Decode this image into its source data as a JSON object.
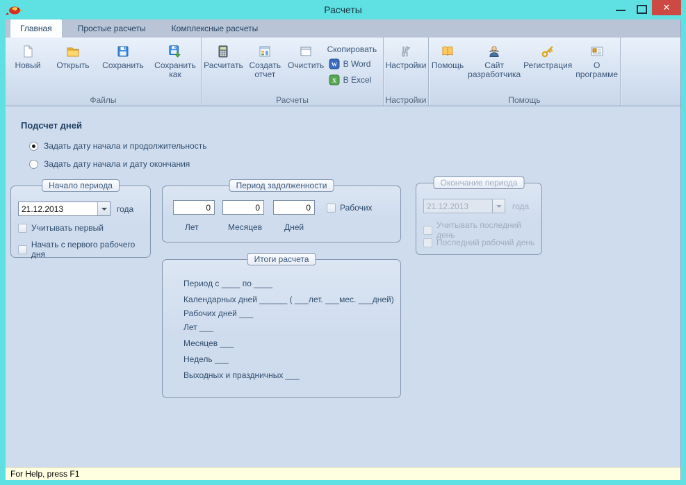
{
  "window": {
    "title": "Расчеты",
    "close_glyph": "✕",
    "status": "For Help, press F1"
  },
  "colors": {
    "frame": "#5fe0e2",
    "close_button": "#cd4a44",
    "content_bg": "#cfdcee",
    "status_bg": "#feffe1",
    "accent_text": "#3a567a"
  },
  "tabs": [
    {
      "label": "Главная",
      "active": true
    },
    {
      "label": "Простые расчеты",
      "active": false
    },
    {
      "label": "Комплексные расчеты",
      "active": false
    }
  ],
  "ribbon": {
    "groups": [
      {
        "label": "Файлы",
        "buttons": [
          {
            "label": "Новый",
            "icon": "new-document-icon"
          },
          {
            "label": "Открыть",
            "icon": "open-folder-icon"
          },
          {
            "label": "Сохранить",
            "icon": "save-icon"
          },
          {
            "label": "Сохранить как",
            "icon": "save-as-icon"
          }
        ]
      },
      {
        "label": "Расчеты",
        "buttons": [
          {
            "label": "Расчитать",
            "icon": "calculator-icon"
          },
          {
            "label": "Создать отчет",
            "icon": "report-icon"
          },
          {
            "label": "Очистить",
            "icon": "clear-window-icon"
          }
        ],
        "copy": {
          "label": "Скопировать",
          "items": [
            {
              "label": "В Word",
              "icon": "word-icon"
            },
            {
              "label": "В Excel",
              "icon": "excel-icon"
            }
          ]
        }
      },
      {
        "label": "Настройки",
        "buttons": [
          {
            "label": "Настройки",
            "icon": "tools-icon"
          }
        ]
      },
      {
        "label": "Помощь",
        "buttons": [
          {
            "label": "Помощь",
            "icon": "book-icon"
          },
          {
            "label": "Сайт разработчика",
            "icon": "person-icon"
          },
          {
            "label": "Регистрация",
            "icon": "key-icon"
          },
          {
            "label": "О программе",
            "icon": "info-card-icon"
          }
        ]
      }
    ]
  },
  "main": {
    "heading": "Подсчет дней",
    "radio_options": [
      {
        "label": "Задать дату начала и продолжительность",
        "selected": true
      },
      {
        "label": "Задать дату начала и дату окончания",
        "selected": false
      }
    ],
    "start_period": {
      "title": "Начало периода",
      "date": "21.12.2013",
      "date_suffix": "года",
      "checkboxes": [
        {
          "label": "Учитывать первый",
          "checked": false
        },
        {
          "label": "Начать с первого рабочего дня",
          "checked": false
        }
      ]
    },
    "debt_period": {
      "title": "Период задолженности",
      "fields": [
        {
          "value": "0",
          "label": "Лет"
        },
        {
          "value": "0",
          "label": "Месяцев"
        },
        {
          "value": "0",
          "label": "Дней"
        }
      ],
      "work_checkbox": {
        "label": "Рабочих",
        "checked": false
      }
    },
    "end_period": {
      "title": "Окончание периода",
      "disabled": true,
      "date": "21.12.2013",
      "date_suffix": "года",
      "checkboxes": [
        {
          "label": "Учитывать последний день",
          "checked": false
        },
        {
          "label": "Последний рабочий день",
          "checked": false
        }
      ]
    },
    "results": {
      "title": "Итоги расчета",
      "lines": [
        "Период с ____ по ____",
        "Календарных дней ______   ( ___лет. ___мес. ___дней)",
        "Рабочих дней ___",
        "Лет ___",
        "Месяцев ___",
        "Недель ___",
        "Выходных и праздничных ___"
      ]
    }
  }
}
